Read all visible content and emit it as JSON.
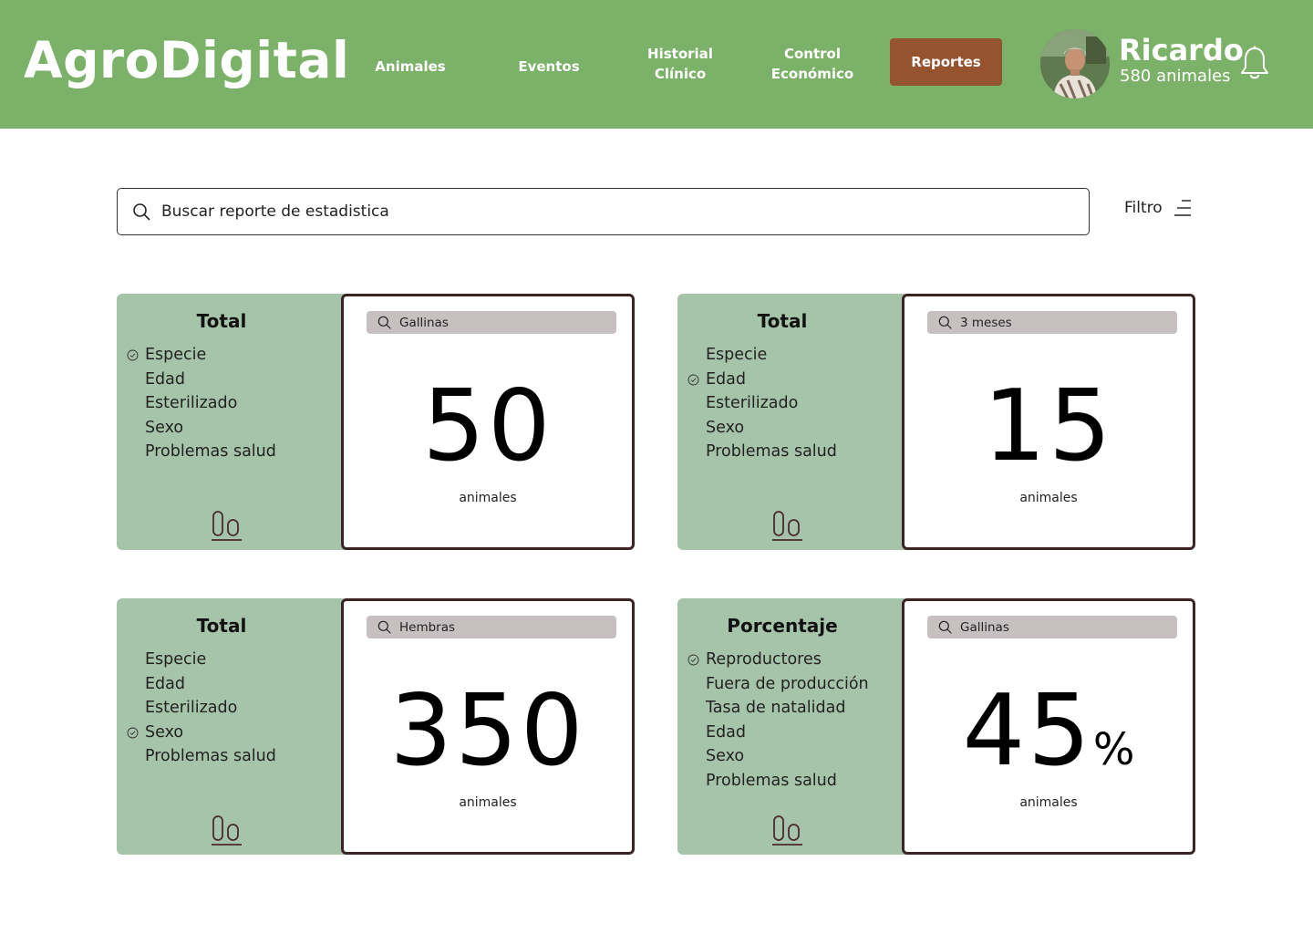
{
  "header": {
    "logo": "AgroDigital",
    "nav": {
      "animales": "Animales",
      "eventos": "Eventos",
      "historial_1": "Historial",
      "historial_2": "Clínico",
      "control_1": "Control",
      "control_2": "Económico",
      "reportes": "Reportes"
    },
    "user": {
      "name": "Ricardo",
      "count": "580 animales"
    }
  },
  "search": {
    "placeholder": "Buscar reporte de estadistica"
  },
  "filter": {
    "label": "Filtro"
  },
  "cards": [
    {
      "title": "Total",
      "options": [
        "Especie",
        "Edad",
        "Esterilizado",
        "Sexo",
        "Problemas salud"
      ],
      "selected": "Especie",
      "filter_value": "Gallinas",
      "value": "50",
      "unit": "animales"
    },
    {
      "title": "Total",
      "options": [
        "Especie",
        "Edad",
        "Esterilizado",
        "Sexo",
        "Problemas salud"
      ],
      "selected": "Edad",
      "filter_value": "3 meses",
      "value": "15",
      "unit": "animales"
    },
    {
      "title": "Total",
      "options": [
        "Especie",
        "Edad",
        "Esterilizado",
        "Sexo",
        "Problemas salud"
      ],
      "selected": "Sexo",
      "filter_value": "Hembras",
      "value": "350",
      "unit": "animales"
    },
    {
      "title": "Porcentaje",
      "options": [
        "Reproductores",
        "Fuera de producción",
        "Tasa de natalidad",
        "Edad",
        "Sexo",
        "Problemas salud"
      ],
      "selected": "Reproductores",
      "filter_value": "Gallinas",
      "value": "45",
      "suffix": "%",
      "unit": "animales"
    }
  ],
  "colors": {
    "header_bg": "#7bb168",
    "reportes_btn": "#965330",
    "card_left_bg": "#a6c4a9",
    "card_border": "#3a2426",
    "mini_search_bg": "#c6c0c1"
  }
}
